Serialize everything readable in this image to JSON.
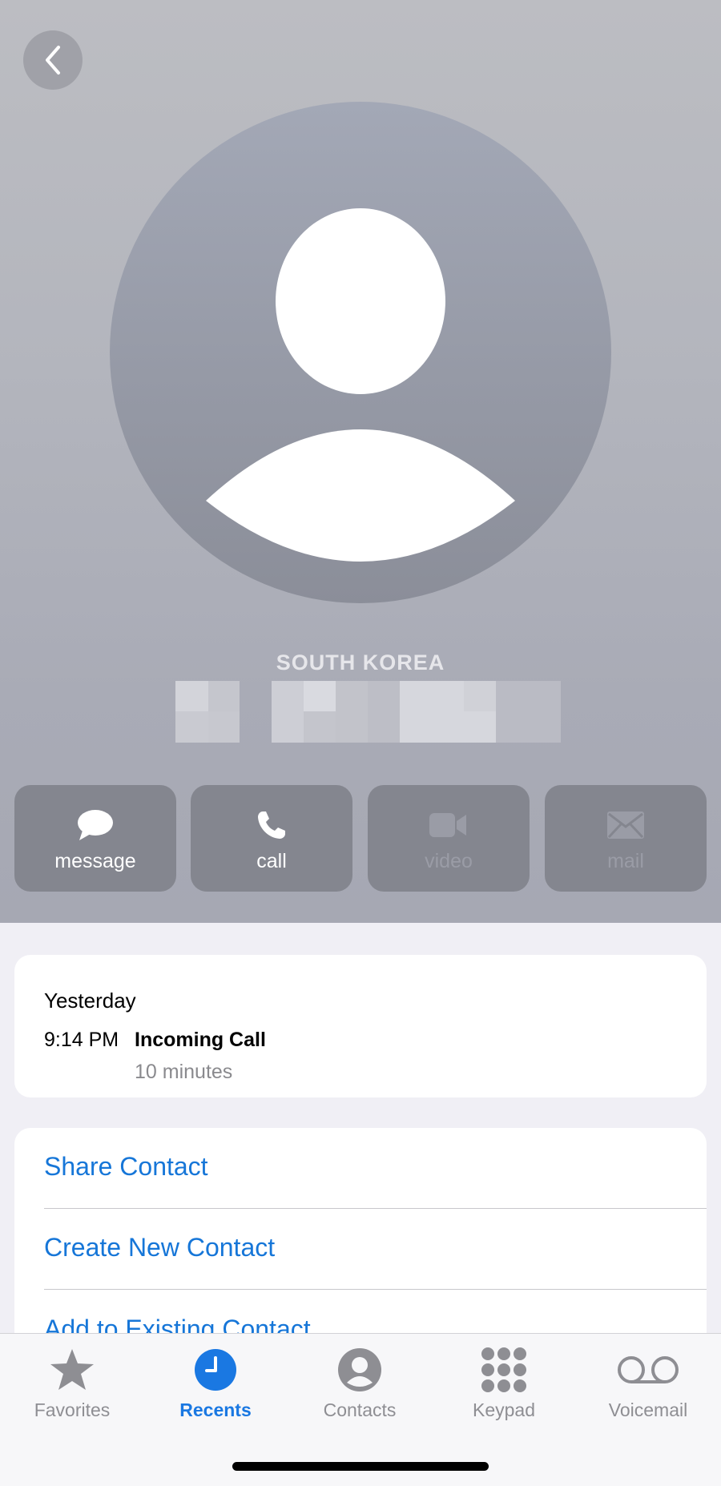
{
  "header": {
    "country": "SOUTH KOREA",
    "number_redacted": true
  },
  "actions": [
    {
      "label": "message",
      "icon": "message-bubble-icon",
      "enabled": true
    },
    {
      "label": "call",
      "icon": "phone-icon",
      "enabled": true
    },
    {
      "label": "video",
      "icon": "video-camera-icon",
      "enabled": false
    },
    {
      "label": "mail",
      "icon": "envelope-icon",
      "enabled": false
    }
  ],
  "recent": {
    "day": "Yesterday",
    "time": "9:14 PM",
    "type": "Incoming Call",
    "duration": "10 minutes"
  },
  "options": [
    {
      "label": "Share Contact"
    },
    {
      "label": "Create New Contact"
    },
    {
      "label": "Add to Existing Contact"
    }
  ],
  "tabbar": {
    "active": "Recents",
    "items": [
      {
        "label": "Favorites",
        "icon": "star-icon"
      },
      {
        "label": "Recents",
        "icon": "clock-icon"
      },
      {
        "label": "Contacts",
        "icon": "person-circle-icon"
      },
      {
        "label": "Keypad",
        "icon": "keypad-grid-icon"
      },
      {
        "label": "Voicemail",
        "icon": "voicemail-icon"
      }
    ]
  },
  "colors": {
    "accent": "#1a78e2",
    "link": "#1676d8",
    "inactive_tab": "#8e8e93",
    "action_bg": "#84868f"
  }
}
